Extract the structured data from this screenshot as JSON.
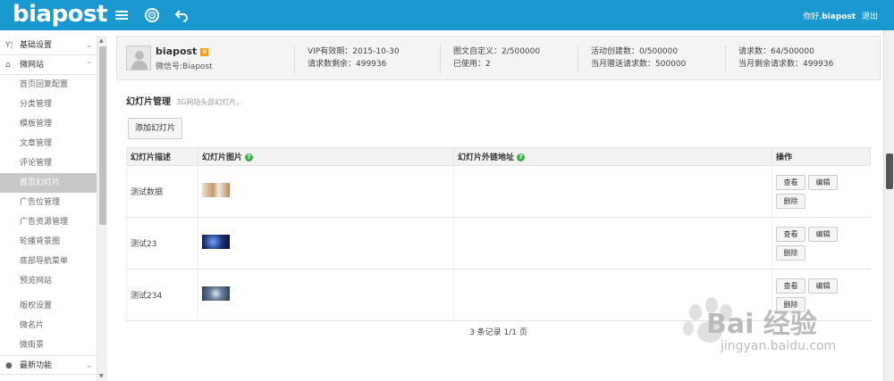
{
  "topbar": {
    "logo": "biapost",
    "greeting": "你好,",
    "username": "biapost",
    "logout": "退出",
    "icons": [
      "menu-icon",
      "target-icon",
      "back-arrow-icon"
    ]
  },
  "sidebar": {
    "groups": [
      {
        "label": "基础设置",
        "icon": "wrench-icon",
        "expanded": false
      },
      {
        "label": "微网站",
        "icon": "home-icon",
        "expanded": true
      },
      {
        "label": "最新功能",
        "icon": "location-icon",
        "expanded": false
      }
    ],
    "items": [
      "首页回复配置",
      "分类管理",
      "模板管理",
      "文章管理",
      "评论管理",
      "首页幻灯片",
      "广告位管理",
      "广告资源管理",
      "轮播背景图",
      "底部导航菜单",
      "预览网站"
    ],
    "items2": [
      "版权设置",
      "微名片",
      "微街景"
    ],
    "active_item": "首页幻灯片"
  },
  "account": {
    "name": "biapost",
    "vip_badge": "V",
    "wechat": "微信号:Biapost",
    "stats": [
      [
        "VIP有效期：2015-10-30",
        "请求数剩余：499936"
      ],
      [
        "图文自定义：2/500000",
        "已使用：2"
      ],
      [
        "活动创建数：0/500000",
        "当月赠送请求数：500000"
      ],
      [
        "请求数：64/500000",
        "当月剩余请求数：499936"
      ]
    ]
  },
  "section": {
    "title": "幻灯片管理",
    "subtitle": "3G网站头部幻灯片。",
    "add_button": "添加幻灯片"
  },
  "table": {
    "headers": [
      "幻灯片描述",
      "幻灯片图片",
      "幻灯片外链地址",
      "操作"
    ],
    "help_glyph": "?",
    "rows": [
      {
        "desc": "测试数据",
        "thumb_color": "#c9b89a",
        "link": ""
      },
      {
        "desc": "测试23",
        "thumb_color": "#1b2c6b",
        "link": ""
      },
      {
        "desc": "测试234",
        "thumb_color": "#3a4d6a",
        "link": ""
      }
    ],
    "op_view": "查看",
    "op_edit": "编辑",
    "op_delete": "删除"
  },
  "pager": "3 条记录 1/1 页",
  "watermark": {
    "brand": "Bai 经验",
    "url": "jingyan.baidu.com"
  }
}
